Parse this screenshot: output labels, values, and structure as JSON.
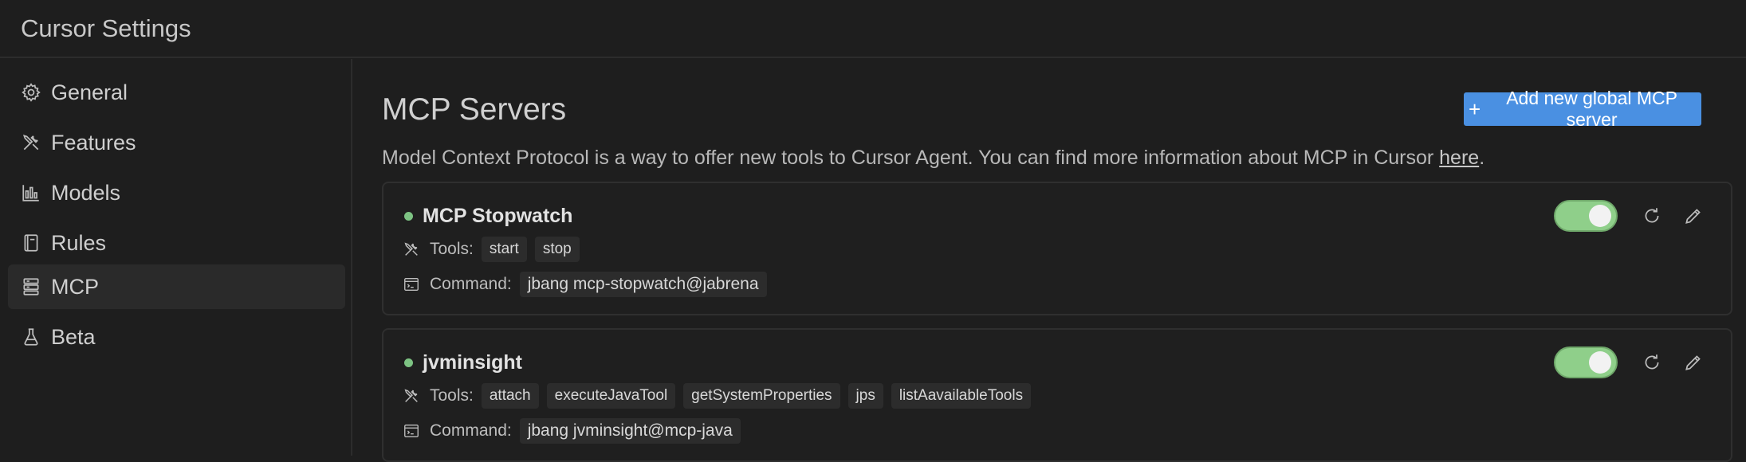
{
  "window": {
    "title": "Cursor Settings"
  },
  "sidebar": {
    "items": [
      {
        "label": "General",
        "icon": "gear-icon",
        "active": false
      },
      {
        "label": "Features",
        "icon": "tools-icon",
        "active": false
      },
      {
        "label": "Models",
        "icon": "chart-icon",
        "active": false
      },
      {
        "label": "Rules",
        "icon": "book-icon",
        "active": false
      },
      {
        "label": "MCP",
        "icon": "server-icon",
        "active": true
      },
      {
        "label": "Beta",
        "icon": "flask-icon",
        "active": false
      }
    ]
  },
  "main": {
    "title": "MCP Servers",
    "add_button_label": "Add new global MCP server",
    "description_text": "Model Context Protocol is a way to offer new tools to Cursor Agent. You can find more information about MCP in Cursor ",
    "description_link": "here",
    "description_end": ".",
    "tools_label": "Tools:",
    "command_label": "Command:",
    "servers": [
      {
        "name": "MCP Stopwatch",
        "enabled": true,
        "tools": [
          "start",
          "stop"
        ],
        "command": "jbang mcp-stopwatch@jabrena"
      },
      {
        "name": "jvminsight",
        "enabled": true,
        "tools": [
          "attach",
          "executeJavaTool",
          "getSystemProperties",
          "jps",
          "listAavailableTools"
        ],
        "command": "jbang jvminsight@mcp-java"
      }
    ]
  },
  "colors": {
    "background": "#1e1e1e",
    "accent": "#4a90e2",
    "status_active": "#7dc383",
    "toggle_on": "#8fcf8a"
  }
}
